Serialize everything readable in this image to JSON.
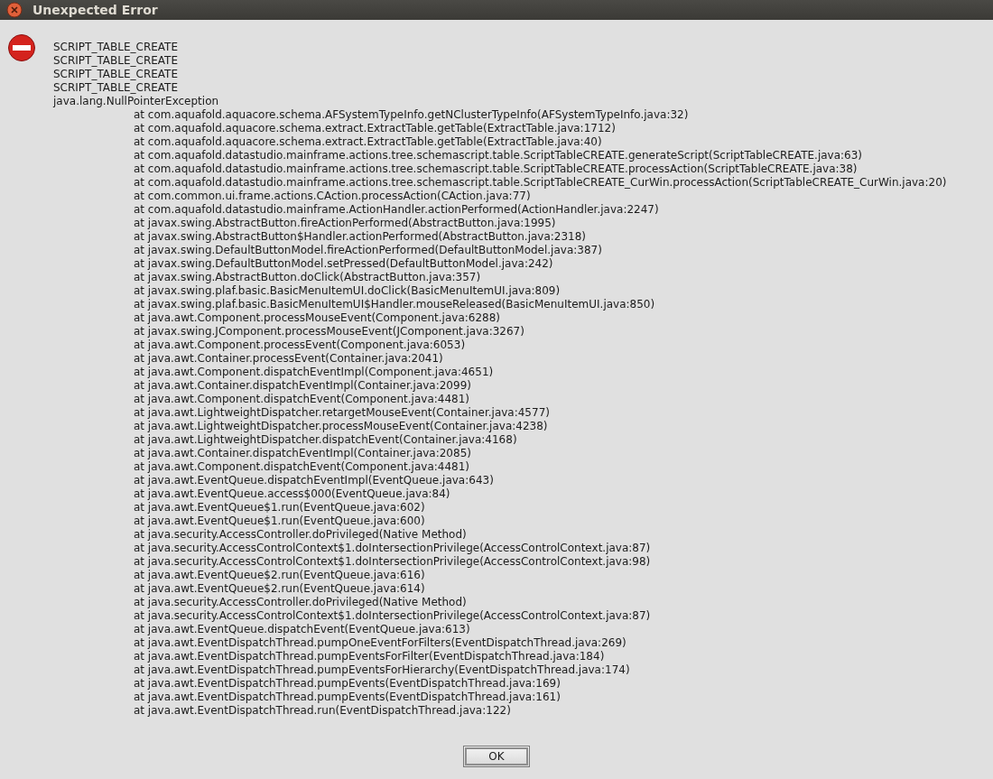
{
  "window": {
    "title": "Unexpected Error"
  },
  "message_lines": [
    "SCRIPT_TABLE_CREATE",
    "SCRIPT_TABLE_CREATE",
    "SCRIPT_TABLE_CREATE",
    "SCRIPT_TABLE_CREATE",
    "java.lang.NullPointerException"
  ],
  "stack_trace": [
    "at com.aquafold.aquacore.schema.AFSystemTypeInfo.getNClusterTypeInfo(AFSystemTypeInfo.java:32)",
    "at com.aquafold.aquacore.schema.extract.ExtractTable.getTable(ExtractTable.java:1712)",
    "at com.aquafold.aquacore.schema.extract.ExtractTable.getTable(ExtractTable.java:40)",
    "at com.aquafold.datastudio.mainframe.actions.tree.schemascript.table.ScriptTableCREATE.generateScript(ScriptTableCREATE.java:63)",
    "at com.aquafold.datastudio.mainframe.actions.tree.schemascript.table.ScriptTableCREATE.processAction(ScriptTableCREATE.java:38)",
    "at com.aquafold.datastudio.mainframe.actions.tree.schemascript.table.ScriptTableCREATE_CurWin.processAction(ScriptTableCREATE_CurWin.java:20)",
    "at com.common.ui.frame.actions.CAction.processAction(CAction.java:77)",
    "at com.aquafold.datastudio.mainframe.ActionHandler.actionPerformed(ActionHandler.java:2247)",
    "at javax.swing.AbstractButton.fireActionPerformed(AbstractButton.java:1995)",
    "at javax.swing.AbstractButton$Handler.actionPerformed(AbstractButton.java:2318)",
    "at javax.swing.DefaultButtonModel.fireActionPerformed(DefaultButtonModel.java:387)",
    "at javax.swing.DefaultButtonModel.setPressed(DefaultButtonModel.java:242)",
    "at javax.swing.AbstractButton.doClick(AbstractButton.java:357)",
    "at javax.swing.plaf.basic.BasicMenuItemUI.doClick(BasicMenuItemUI.java:809)",
    "at javax.swing.plaf.basic.BasicMenuItemUI$Handler.mouseReleased(BasicMenuItemUI.java:850)",
    "at java.awt.Component.processMouseEvent(Component.java:6288)",
    "at javax.swing.JComponent.processMouseEvent(JComponent.java:3267)",
    "at java.awt.Component.processEvent(Component.java:6053)",
    "at java.awt.Container.processEvent(Container.java:2041)",
    "at java.awt.Component.dispatchEventImpl(Component.java:4651)",
    "at java.awt.Container.dispatchEventImpl(Container.java:2099)",
    "at java.awt.Component.dispatchEvent(Component.java:4481)",
    "at java.awt.LightweightDispatcher.retargetMouseEvent(Container.java:4577)",
    "at java.awt.LightweightDispatcher.processMouseEvent(Container.java:4238)",
    "at java.awt.LightweightDispatcher.dispatchEvent(Container.java:4168)",
    "at java.awt.Container.dispatchEventImpl(Container.java:2085)",
    "at java.awt.Component.dispatchEvent(Component.java:4481)",
    "at java.awt.EventQueue.dispatchEventImpl(EventQueue.java:643)",
    "at java.awt.EventQueue.access$000(EventQueue.java:84)",
    "at java.awt.EventQueue$1.run(EventQueue.java:602)",
    "at java.awt.EventQueue$1.run(EventQueue.java:600)",
    "at java.security.AccessController.doPrivileged(Native Method)",
    "at java.security.AccessControlContext$1.doIntersectionPrivilege(AccessControlContext.java:87)",
    "at java.security.AccessControlContext$1.doIntersectionPrivilege(AccessControlContext.java:98)",
    "at java.awt.EventQueue$2.run(EventQueue.java:616)",
    "at java.awt.EventQueue$2.run(EventQueue.java:614)",
    "at java.security.AccessController.doPrivileged(Native Method)",
    "at java.security.AccessControlContext$1.doIntersectionPrivilege(AccessControlContext.java:87)",
    "at java.awt.EventQueue.dispatchEvent(EventQueue.java:613)",
    "at java.awt.EventDispatchThread.pumpOneEventForFilters(EventDispatchThread.java:269)",
    "at java.awt.EventDispatchThread.pumpEventsForFilter(EventDispatchThread.java:184)",
    "at java.awt.EventDispatchThread.pumpEventsForHierarchy(EventDispatchThread.java:174)",
    "at java.awt.EventDispatchThread.pumpEvents(EventDispatchThread.java:169)",
    "at java.awt.EventDispatchThread.pumpEvents(EventDispatchThread.java:161)",
    "at java.awt.EventDispatchThread.run(EventDispatchThread.java:122)"
  ],
  "buttons": [
    "OK"
  ]
}
